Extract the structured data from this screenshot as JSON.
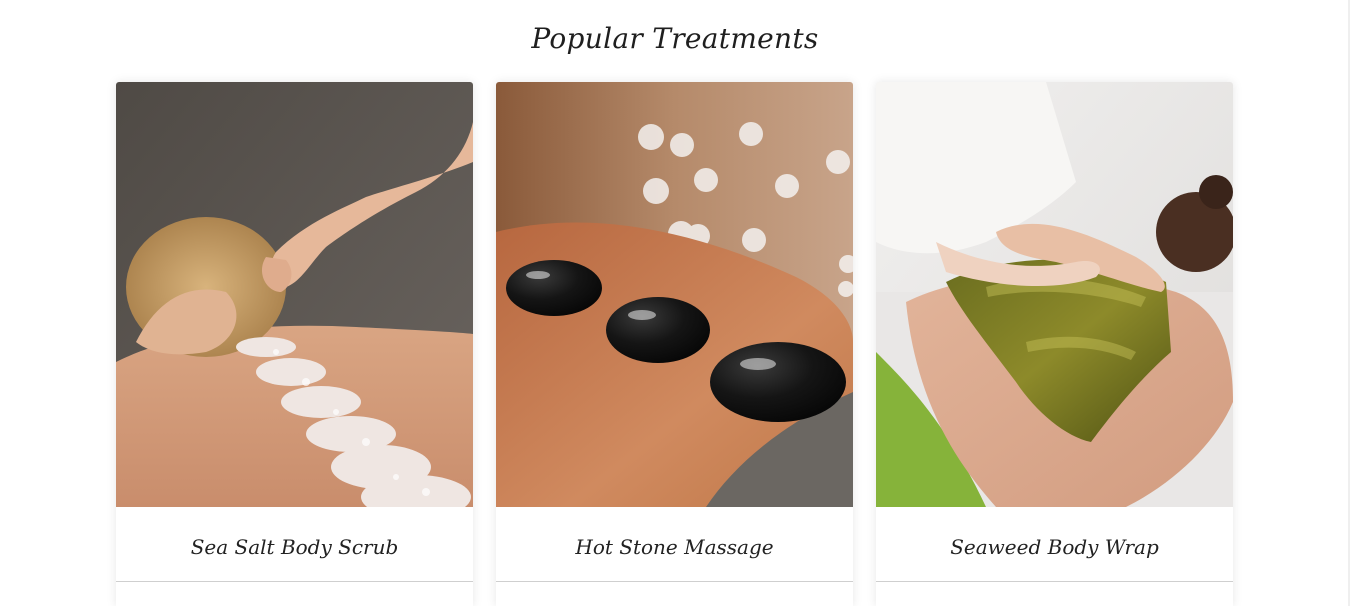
{
  "section": {
    "title": "Popular Treatments"
  },
  "treatments": [
    {
      "title": "Sea Salt Body Scrub",
      "image": "sea-salt-scrub-photo"
    },
    {
      "title": "Hot Stone Massage",
      "image": "hot-stone-massage-photo"
    },
    {
      "title": "Seaweed Body Wrap",
      "image": "seaweed-wrap-photo"
    }
  ],
  "colors": {
    "title_text": "#1f1f1f",
    "card_background": "#ffffff",
    "divider": "#cfcfcf"
  }
}
